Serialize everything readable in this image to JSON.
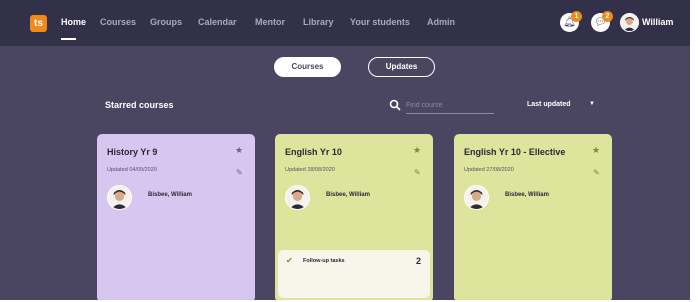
{
  "app": {
    "logo_text": "ts",
    "logo_color": "#f08a1c"
  },
  "nav": {
    "items": [
      {
        "label": "Home",
        "active": true
      },
      {
        "label": "Courses",
        "active": false
      },
      {
        "label": "Groups",
        "active": false
      },
      {
        "label": "Calendar",
        "active": false
      },
      {
        "label": "Mentor",
        "active": false
      },
      {
        "label": "Library",
        "active": false
      },
      {
        "label": "Your students",
        "active": false
      },
      {
        "label": "Admin",
        "active": false
      }
    ]
  },
  "header": {
    "notifications": {
      "icon": "bell-icon",
      "badge": "1"
    },
    "messages": {
      "icon": "chat-icon",
      "badge": "2"
    },
    "user": {
      "name": "William",
      "avatar_icon": "user-avatar"
    }
  },
  "view_toggle": {
    "options": [
      "Courses",
      "Updates"
    ],
    "selected": "Courses"
  },
  "starred": {
    "title": "Starred courses",
    "search": {
      "placeholder": "Find course",
      "value": "",
      "icon": "search-icon"
    },
    "sort": {
      "label": "Last updated",
      "icon": "caret-down-icon"
    }
  },
  "courses": [
    {
      "title": "History Yr 9",
      "updated": "Updated 04/09/2020",
      "teacher": "Bisbee, William",
      "color": "#d7c6f0",
      "accent": "#6f5a8f",
      "starred": true
    },
    {
      "title": "English Yr 10",
      "updated": "Updated 28/08/2020",
      "teacher": "Bisbee, William",
      "color": "#dde49c",
      "accent": "#7a8a2e",
      "starred": true,
      "tasks": {
        "label": "Follow-up tasks",
        "count": "2"
      }
    },
    {
      "title": "English Yr 10 - Ellective",
      "updated": "Updated 27/08/2020",
      "teacher": "Bisbee, William",
      "color": "#dde49c",
      "accent": "#7a8a2e",
      "starred": true
    }
  ],
  "colors": {
    "background": "#4a4560",
    "topbar": "#33304a",
    "badge": "#f08a1c"
  }
}
